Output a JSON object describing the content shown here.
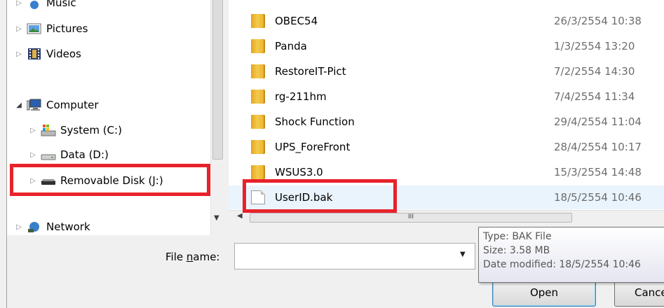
{
  "nav": {
    "items": [
      {
        "label": "Music",
        "icon": "music-icon"
      },
      {
        "label": "Pictures",
        "icon": "pictures-icon"
      },
      {
        "label": "Videos",
        "icon": "videos-icon"
      },
      {
        "label": "Computer",
        "icon": "computer-icon"
      },
      {
        "label": "System (C:)",
        "icon": "system-drive-icon"
      },
      {
        "label": "Data (D:)",
        "icon": "drive-icon"
      },
      {
        "label": "Removable Disk (J:)",
        "icon": "removable-disk-icon"
      },
      {
        "label": "Network",
        "icon": "network-icon"
      }
    ]
  },
  "files": [
    {
      "name": "OBEC54",
      "date": "26/3/2554 10:38",
      "type": "folder"
    },
    {
      "name": "Panda",
      "date": "1/3/2554 13:20",
      "type": "folder"
    },
    {
      "name": "RestoreIT-Pict",
      "date": "7/2/2554 14:30",
      "type": "folder"
    },
    {
      "name": "rg-211hm",
      "date": "7/4/2554 11:34",
      "type": "folder"
    },
    {
      "name": "Shock Function",
      "date": "29/4/2554 11:04",
      "type": "folder"
    },
    {
      "name": "UPS_ForeFront",
      "date": "28/4/2554 10:17",
      "type": "folder"
    },
    {
      "name": "WSUS3.0",
      "date": "15/3/2554 14:48",
      "type": "folder"
    },
    {
      "name": "UserID.bak",
      "date": "18/5/2554 10:46",
      "type": "file"
    }
  ],
  "scroll": {
    "thumb_grip": "III"
  },
  "filename": {
    "label_pre": "File ",
    "label_key": "n",
    "label_post": "ame:",
    "value": ""
  },
  "buttons": {
    "open": "Open",
    "cancel": "Cancel"
  },
  "tooltip": {
    "type": "Type: BAK File",
    "size": "Size: 3.58 MB",
    "modified": "Date modified: 18/5/2554 10:46"
  },
  "colors": {
    "highlight": "#e8222b",
    "selected_row": "#eaf4fc"
  }
}
